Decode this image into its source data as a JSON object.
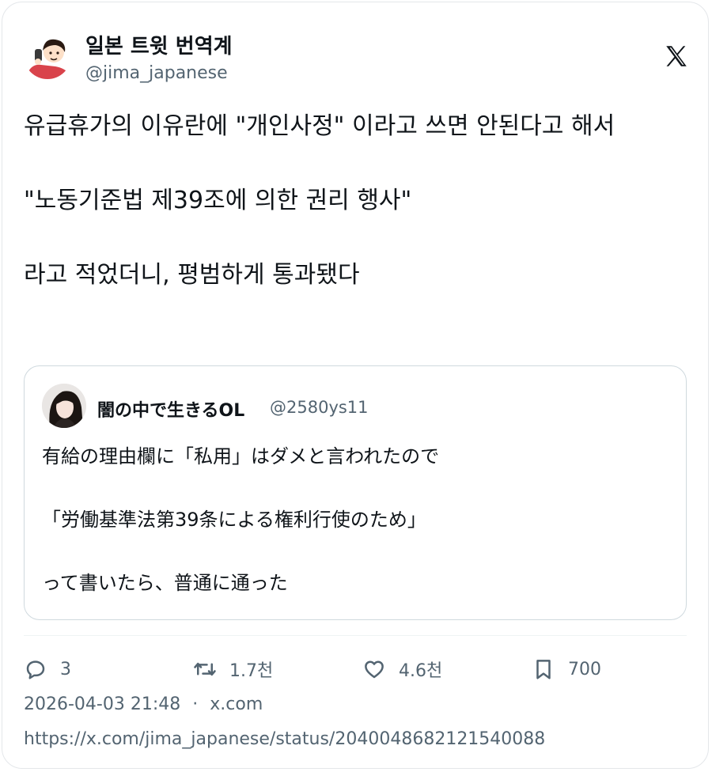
{
  "author": {
    "name": "일본 트윗 번역계",
    "handle": "@jima_japanese"
  },
  "tweet": {
    "paragraphs": [
      "유급휴가의 이유란에 \"개인사정\" 이라고 쓰면 안된다고 해서",
      "\"노동기준법 제39조에 의한 권리 행사\"",
      "라고 적었더니, 평범하게 통과됐다"
    ]
  },
  "quote": {
    "name": "闇の中で生きるOL",
    "handle": "@2580ys11",
    "paragraphs": [
      "有給の理由欄に「私用」はダメと言われたので",
      "「労働基準法第39条による権利行使のため」",
      "って書いたら、普通に通った"
    ]
  },
  "actions": {
    "replies": "3",
    "reposts": "1.7천",
    "likes": "4.6천",
    "bookmarks": "700"
  },
  "meta": {
    "datetime": "2026-04-03 21:48",
    "separator": "·",
    "source": "x.com"
  },
  "url": "https://x.com/jima_japanese/status/2040048682121540088",
  "colors": {
    "text": "#0f1419",
    "secondary": "#536471",
    "border": "#cfd9de"
  },
  "icons": [
    "x-logo-icon",
    "reply-icon",
    "repost-icon",
    "like-icon",
    "bookmark-icon"
  ]
}
